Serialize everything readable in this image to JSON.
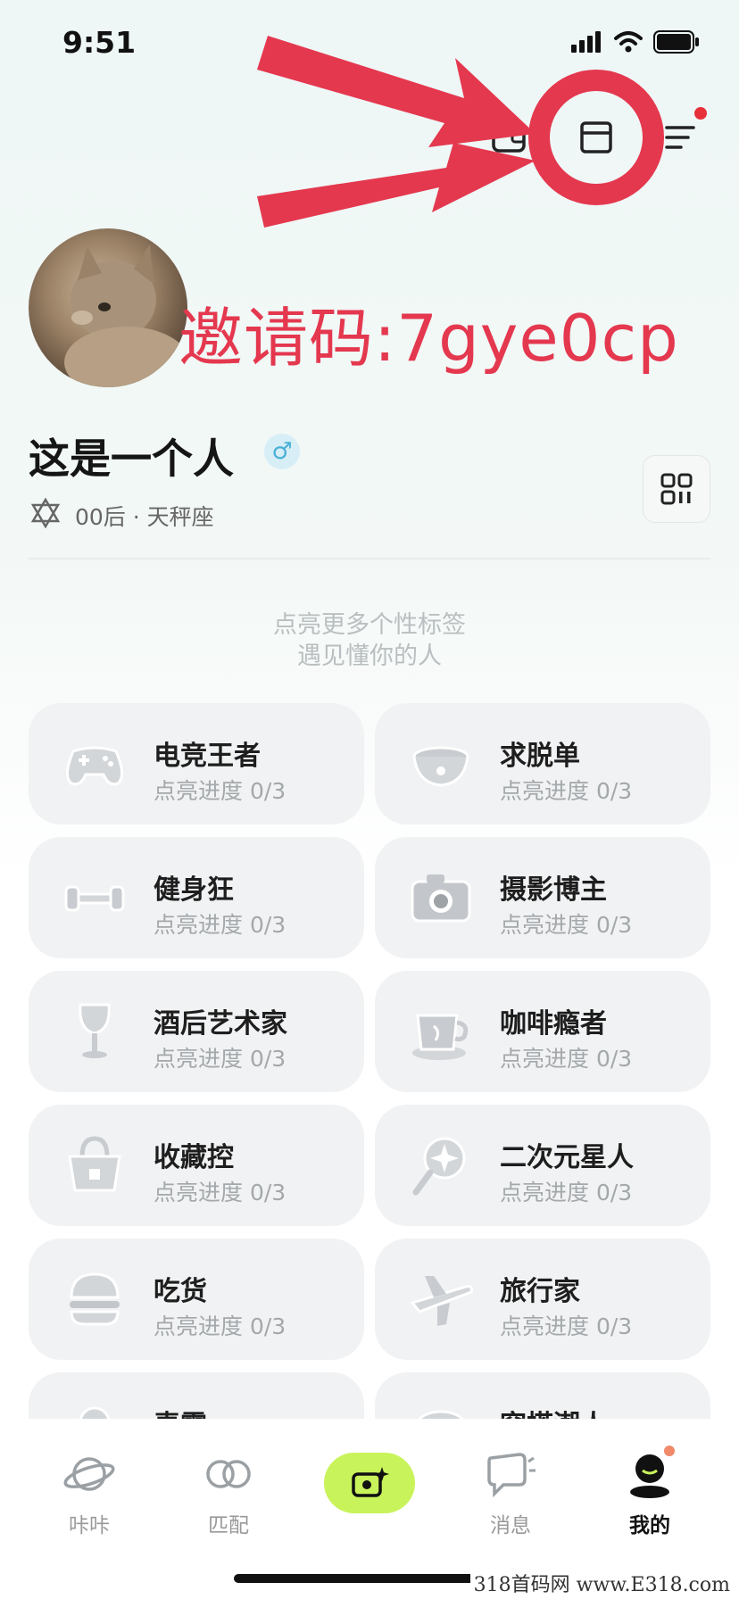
{
  "status_bar": {
    "time": "9:51"
  },
  "annotation": {
    "invite_text": "邀请码:7gye0cp",
    "accent": "#e4384f"
  },
  "profile": {
    "name": "这是一个人",
    "gender_symbol": "♂",
    "meta": "00后 · 天秤座"
  },
  "prompt": {
    "line1": "点亮更多个性标签",
    "line2": "遇见懂你的人"
  },
  "tags": [
    {
      "title": "电竞王者",
      "progress": "点亮进度 0/3",
      "icon": "gamepad-icon"
    },
    {
      "title": "求脱单",
      "progress": "点亮进度 0/3",
      "icon": "pet-bowl-icon"
    },
    {
      "title": "健身狂",
      "progress": "点亮进度 0/3",
      "icon": "dumbbell-icon"
    },
    {
      "title": "摄影博主",
      "progress": "点亮进度 0/3",
      "icon": "camera-icon"
    },
    {
      "title": "酒后艺术家",
      "progress": "点亮进度 0/3",
      "icon": "wine-glass-icon"
    },
    {
      "title": "咖啡瘾者",
      "progress": "点亮进度 0/3",
      "icon": "coffee-cup-icon"
    },
    {
      "title": "收藏控",
      "progress": "点亮进度 0/3",
      "icon": "handbag-icon"
    },
    {
      "title": "二次元星人",
      "progress": "点亮进度 0/3",
      "icon": "magic-wand-icon"
    },
    {
      "title": "吃货",
      "progress": "点亮进度 0/3",
      "icon": "burger-icon"
    },
    {
      "title": "旅行家",
      "progress": "点亮进度 0/3",
      "icon": "airplane-icon"
    },
    {
      "title": "麦霸",
      "progress": "",
      "icon": "microphone-icon"
    },
    {
      "title": "穿搭潮人",
      "progress": "",
      "icon": "hat-icon"
    }
  ],
  "tabbar": {
    "tabs": [
      {
        "label": "咔咔",
        "icon": "planet-icon"
      },
      {
        "label": "匹配",
        "icon": "rings-icon"
      },
      {
        "label": "",
        "icon": "camera-sparkle-icon"
      },
      {
        "label": "消息",
        "icon": "chat-bubble-icon"
      },
      {
        "label": "我的",
        "icon": "profile-icon"
      }
    ],
    "accent": "#c8f35a"
  },
  "watermark": "318首码网 www.E318.com"
}
